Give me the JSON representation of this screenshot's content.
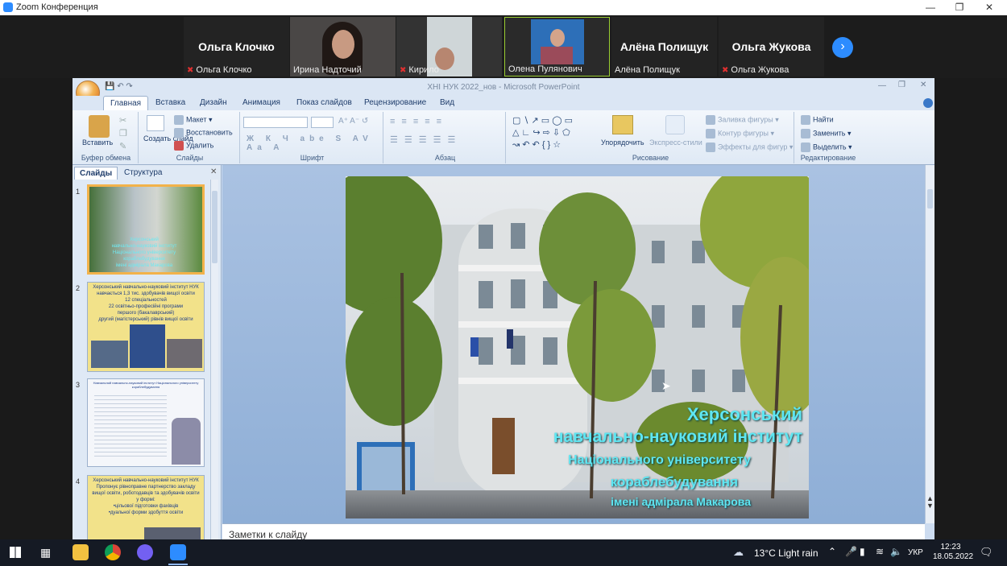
{
  "zoom": {
    "title": "Zoom Конференция"
  },
  "participants": [
    {
      "display_name": "Ольга Клочко",
      "caption": "Ольга Клочко",
      "muted": true,
      "video": false
    },
    {
      "display_name": "",
      "caption": "Ирина Надточий",
      "muted": false,
      "video": true
    },
    {
      "display_name": "",
      "caption": "Кирило",
      "muted": true,
      "video": true
    },
    {
      "display_name": "",
      "caption": "Олена Пулянович",
      "muted": false,
      "video": true,
      "active_speaker": true
    },
    {
      "display_name": "Алёна Полищук",
      "caption": "Алёна Полищук",
      "muted": false,
      "video": false
    },
    {
      "display_name": "Ольга Жукова",
      "caption": "Ольга Жукова",
      "muted": true,
      "video": false
    }
  ],
  "ppt": {
    "title": "ХНІ НУК 2022_нов - Microsoft PowerPoint",
    "tabs": [
      "Главная",
      "Вставка",
      "Дизайн",
      "Анимация",
      "Показ слайдов",
      "Рецензирование",
      "Вид"
    ],
    "active_tab": "Главная",
    "ribbon": {
      "paste": "Вставить",
      "clipboard_group": "Буфер обмена",
      "layout": "Макет",
      "reset": "Восстановить",
      "create_slide": "Создать слайд",
      "delete": "Удалить",
      "slides_group": "Слайды",
      "font_group": "Шрифт",
      "paragraph_group": "Абзац",
      "arrange": "Упорядочить",
      "quick_styles": "Экспресс-стили",
      "shape_fill": "Заливка фигуры",
      "shape_outline": "Контур фигуры",
      "shape_effects": "Эффекты для фигур",
      "drawing_group": "Рисование",
      "find": "Найти",
      "replace": "Заменить",
      "select": "Выделить",
      "editing_group": "Редактирование"
    },
    "pane_tabs": [
      "Слайды",
      "Структура"
    ],
    "thumbnails": [
      {
        "num": "1",
        "lines": [
          "Херсонський",
          "навчально-науковий інститут",
          "Національного університету",
          "кораблебудування",
          "імені адмірала Макарова"
        ]
      },
      {
        "num": "2",
        "lines": [
          "Херсонський навчально-науковий інститут НУК",
          "навчається 1,3 тис. здобувачів вищої освіти",
          "12 спеціальностей",
          "22 освітньо-професійні програми",
          "першого (бакалаврський)",
          "другий (магістерський) рівнів вищої освіти"
        ]
      },
      {
        "num": "3",
        "lines": [
          "Навчальний навчально-науковий інститут Національного університету кораблебудування"
        ]
      },
      {
        "num": "4",
        "lines": [
          "Херсонський навчально-науковий інститут НУК",
          "Пропонує рівноправне партнерство закладу",
          "вищої освіти, роботодавців та здобувачів освіти",
          "у формі:",
          "•цільової підготовки фахівців",
          "•дуальної форми здобуття освіти"
        ]
      }
    ],
    "slide": {
      "line1": "Херсонський",
      "line2": "навчально-науковий інститут",
      "line3": "Національного університету",
      "line4": "кораблебудування",
      "line5": "імені адмірала Макарова"
    },
    "notes_placeholder": "Заметки к слайду"
  },
  "taskbar": {
    "weather": "13°C  Light rain",
    "language": "УКР",
    "time": "12:23",
    "date": "18.05.2022"
  }
}
